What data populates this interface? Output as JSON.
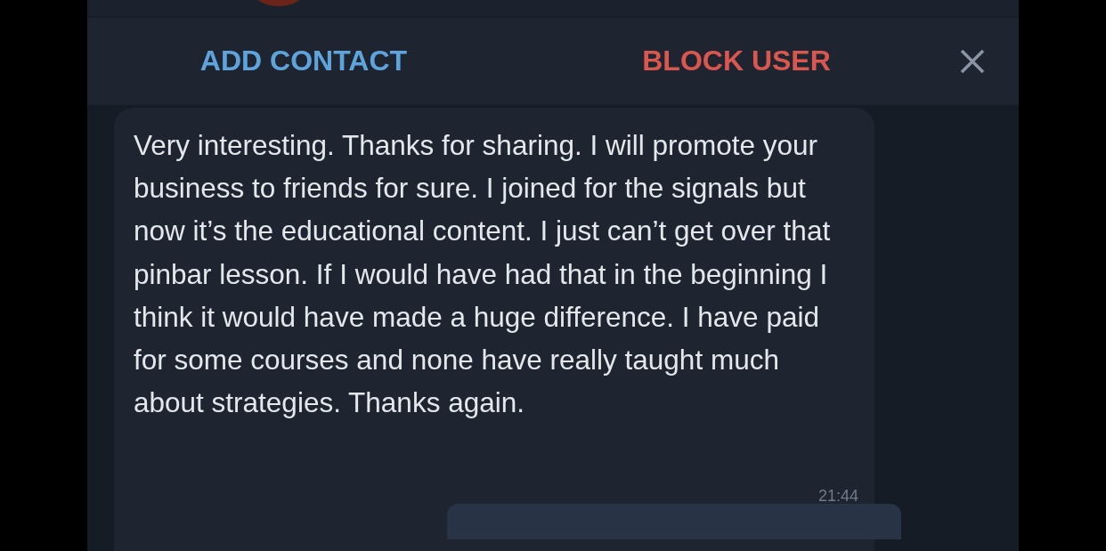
{
  "actions": {
    "add_contact": "ADD CONTACT",
    "block_user": "BLOCK USER"
  },
  "message": {
    "text": "Very interesting. Thanks for sharing. I will promote your business to friends for sure. I joined for the signals but now it’s the educational content. I just can’t get over that pinbar lesson. If I would have had that in the beginning I think it would have made a huge difference. I have paid for some courses and none have really taught much about strategies. Thanks again.",
    "time": "21:44"
  }
}
